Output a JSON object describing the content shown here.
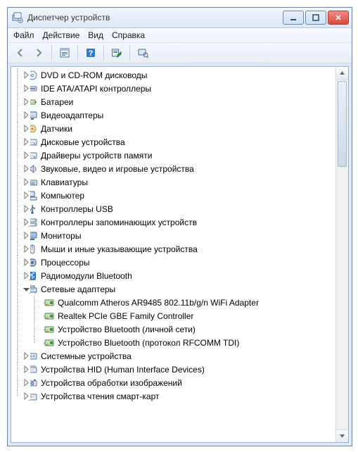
{
  "window": {
    "title": "Диспетчер устройств"
  },
  "menu": {
    "file": "Файл",
    "action": "Действие",
    "view": "Вид",
    "help": "Справка"
  },
  "tree": {
    "nodes": [
      {
        "id": "dvd",
        "label": "DVD и CD-ROM дисководы",
        "icon": "disc"
      },
      {
        "id": "ide",
        "label": "IDE ATA/ATAPI контроллеры",
        "icon": "ide"
      },
      {
        "id": "battery",
        "label": "Батареи",
        "icon": "battery"
      },
      {
        "id": "video",
        "label": "Видеоадаптеры",
        "icon": "display"
      },
      {
        "id": "sensors",
        "label": "Датчики",
        "icon": "sensor"
      },
      {
        "id": "disk",
        "label": "Дисковые устройства",
        "icon": "drive"
      },
      {
        "id": "memdrv",
        "label": "Драйверы устройств памяти",
        "icon": "drive"
      },
      {
        "id": "sound",
        "label": "Звуковые, видео и игровые устройства",
        "icon": "speaker"
      },
      {
        "id": "keyboard",
        "label": "Клавиатуры",
        "icon": "keyboard"
      },
      {
        "id": "computer",
        "label": "Компьютер",
        "icon": "computer"
      },
      {
        "id": "usb",
        "label": "Контроллеры USB",
        "icon": "usb"
      },
      {
        "id": "storage",
        "label": "Контроллеры запоминающих устройств",
        "icon": "storage"
      },
      {
        "id": "monitor",
        "label": "Мониторы",
        "icon": "monitor"
      },
      {
        "id": "mouse",
        "label": "Мыши и иные указывающие устройства",
        "icon": "mouse"
      },
      {
        "id": "cpu",
        "label": "Процессоры",
        "icon": "cpu"
      },
      {
        "id": "btradio",
        "label": "Радиомодули Bluetooth",
        "icon": "bluetooth"
      },
      {
        "id": "network",
        "label": "Сетевые адаптеры",
        "icon": "network",
        "expanded": true,
        "children": [
          {
            "id": "net-wifi",
            "label": "Qualcomm Atheros AR9485 802.11b/g/n WiFi Adapter",
            "icon": "nic"
          },
          {
            "id": "net-gbe",
            "label": "Realtek PCIe GBE Family Controller",
            "icon": "nic"
          },
          {
            "id": "net-btpan",
            "label": "Устройство Bluetooth (личной сети)",
            "icon": "nic"
          },
          {
            "id": "net-btrf",
            "label": "Устройство Bluetooth (протокол RFCOMM TDI)",
            "icon": "nic"
          }
        ]
      },
      {
        "id": "system",
        "label": "Системные устройства",
        "icon": "system"
      },
      {
        "id": "hid",
        "label": "Устройства HID (Human Interface Devices)",
        "icon": "hid"
      },
      {
        "id": "imaging",
        "label": "Устройства обработки изображений",
        "icon": "imaging"
      },
      {
        "id": "smartcard",
        "label": "Устройства чтения смарт-карт",
        "icon": "smartcard"
      }
    ]
  }
}
